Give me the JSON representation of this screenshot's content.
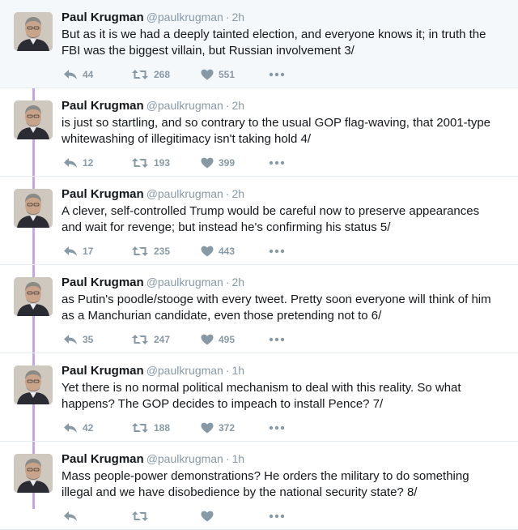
{
  "colors": {
    "thread_line": "#c3a7e8",
    "meta_gray": "#8899a6",
    "text": "#14171a",
    "first_bg": "#f5f8fa"
  },
  "icons": {
    "reply": "reply-icon",
    "retweet": "retweet-icon",
    "like": "heart-icon",
    "more": "more-dots-icon",
    "avatar": "avatar"
  },
  "tweets": [
    {
      "name": "Paul Krugman",
      "handle": "@paulkrugman",
      "sep": "·",
      "time": "2h",
      "text": "But as it is we had a deeply tainted election, and everyone knows it; in truth the FBI was the biggest villain, but Russian involvement 3/",
      "replies": "44",
      "retweets": "268",
      "likes": "551"
    },
    {
      "name": "Paul Krugman",
      "handle": "@paulkrugman",
      "sep": "·",
      "time": "2h",
      "text": "is just so startling, and so contrary to the usual GOP flag-waving, that 2001-type whitewashing of illegitimacy isn't taking hold 4/",
      "replies": "12",
      "retweets": "193",
      "likes": "399"
    },
    {
      "name": "Paul Krugman",
      "handle": "@paulkrugman",
      "sep": "·",
      "time": "2h",
      "text": "A clever, self-controlled Trump would be careful now to preserve appearances and wait for revenge; but instead he's confirming his status 5/",
      "replies": "17",
      "retweets": "235",
      "likes": "443"
    },
    {
      "name": "Paul Krugman",
      "handle": "@paulkrugman",
      "sep": "·",
      "time": "2h",
      "text": "as Putin's poodle/stooge with every tweet. Pretty soon everyone will think of him as a Manchurian candidate, even those pretending not to 6/",
      "replies": "35",
      "retweets": "247",
      "likes": "495"
    },
    {
      "name": "Paul Krugman",
      "handle": "@paulkrugman",
      "sep": "·",
      "time": "1h",
      "text": "Yet there is no normal political mechanism to deal with this reality. So what happens? The GOP decides to impeach to install Pence? 7/",
      "replies": "42",
      "retweets": "188",
      "likes": "372"
    },
    {
      "name": "Paul Krugman",
      "handle": "@paulkrugman",
      "sep": "·",
      "time": "1h",
      "text": "Mass people-power demonstrations? He orders the military to do something illegal and we have disobedience by the national security state? 8/",
      "replies": "",
      "retweets": "",
      "likes": ""
    }
  ]
}
